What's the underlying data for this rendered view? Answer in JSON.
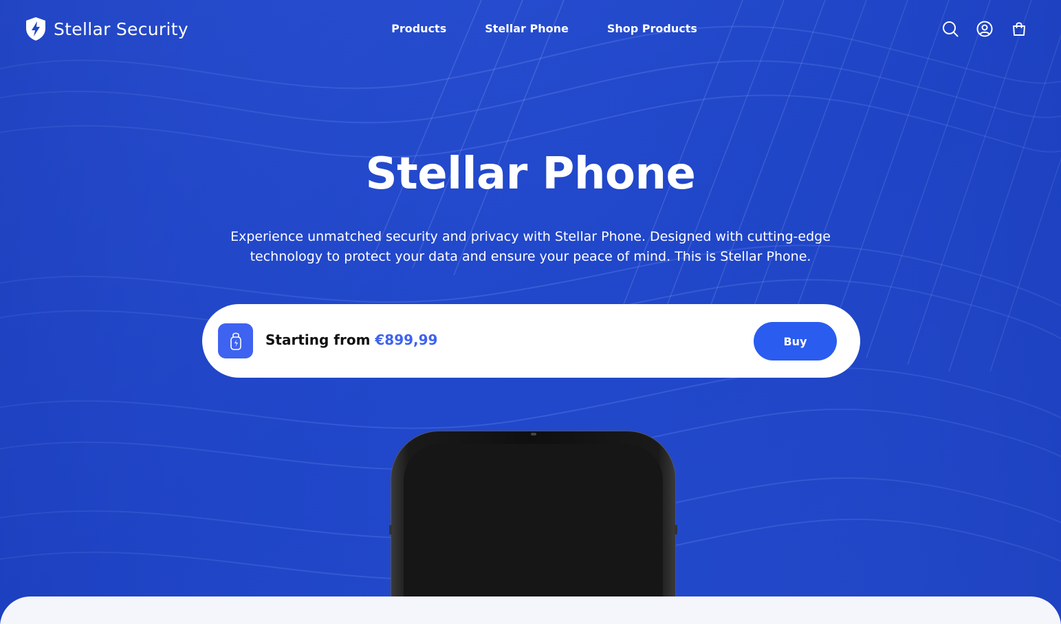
{
  "brand": {
    "name": "Stellar Security",
    "logo_icon": "shield-bolt-icon"
  },
  "nav": {
    "items": [
      {
        "label": "Products"
      },
      {
        "label": "Stellar Phone"
      },
      {
        "label": "Shop Products"
      }
    ]
  },
  "header_icons": [
    "search-icon",
    "account-icon",
    "cart-icon"
  ],
  "hero": {
    "title": "Stellar Phone",
    "description": "Experience unmatched security and privacy with Stellar Phone. Designed with cutting-edge technology to protect your data and ensure your peace of mind. This is Stellar Phone."
  },
  "price_bar": {
    "icon": "secure-phone-icon",
    "prefix": "Starting from",
    "price": "€899,99",
    "buy_label": "Buy"
  },
  "colors": {
    "background": "#2247c9",
    "accent": "#3e63f0",
    "button": "#2a5cf0",
    "panel": "#f5f6fb"
  }
}
